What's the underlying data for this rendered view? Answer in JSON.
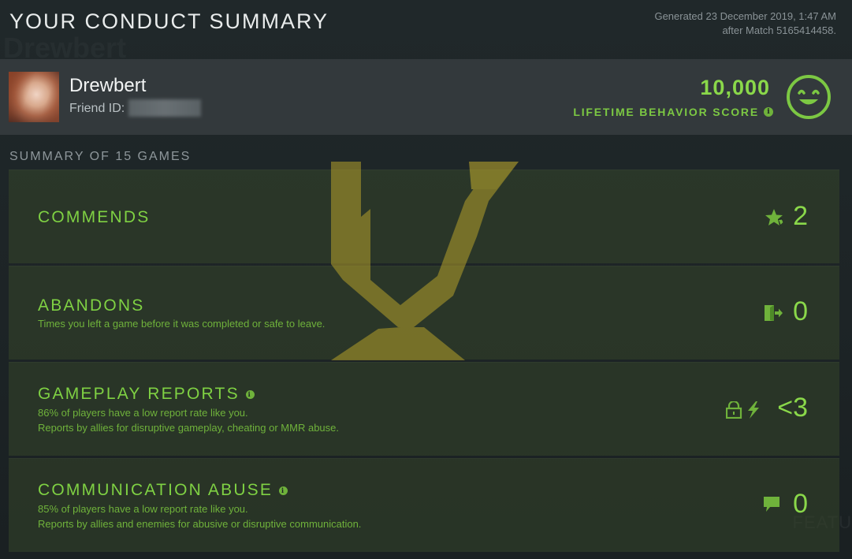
{
  "header": {
    "title": "YOUR CONDUCT SUMMARY",
    "generated_line1": "Generated 23 December 2019, 1:47 AM",
    "generated_line2": "after Match 5165414458."
  },
  "background": {
    "ghost_name": "Drewbert",
    "ghost_right": "FEATU"
  },
  "profile": {
    "username": "Drewbert",
    "friend_id_label": "Friend ID:",
    "score_value": "10,000",
    "score_label": "LIFETIME BEHAVIOR SCORE",
    "info_glyph": "i"
  },
  "summary": {
    "heading": "SUMMARY OF 15 GAMES",
    "rows": [
      {
        "title": "COMMENDS",
        "desc1": "",
        "desc2": "",
        "value": "2",
        "icon": "commend-star-icon"
      },
      {
        "title": "ABANDONS",
        "desc1": "Times you left a game before it was completed or safe to leave.",
        "desc2": "",
        "value": "0",
        "icon": "exit-door-icon"
      },
      {
        "title": "GAMEPLAY REPORTS",
        "desc1": "86% of players have a low report rate like you.",
        "desc2": "Reports by allies for disruptive gameplay, cheating or MMR abuse.",
        "value": "<3",
        "icon": "lock-lightning-icon"
      },
      {
        "title": "COMMUNICATION ABUSE",
        "desc1": "85% of players have a low report rate like you.",
        "desc2": "Reports by allies and enemies for abusive or disruptive communication.",
        "value": "0",
        "icon": "chat-bubble-icon"
      }
    ]
  },
  "colors": {
    "accent_green": "#8ad84a",
    "row_bg": "#34462a",
    "emblem_gold": "#b5a12a"
  }
}
